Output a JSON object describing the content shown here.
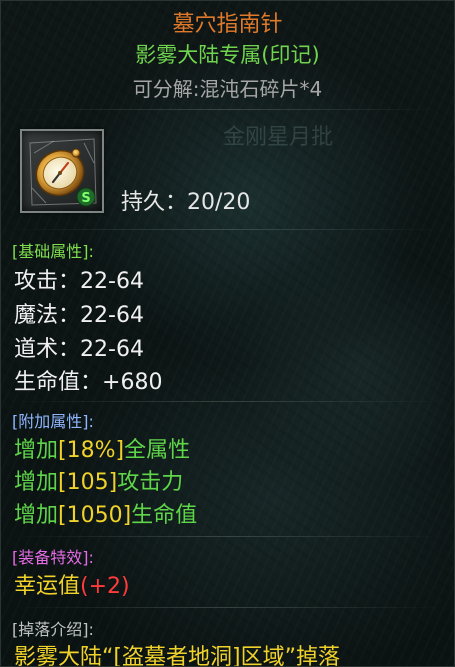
{
  "item": {
    "name": "墓穴指南针",
    "exclusive": "影雾大陆专属(印记)",
    "decompose": "可分解:混沌石碎片*4",
    "watermark": "金刚星月批",
    "icon_badge": "S",
    "durability": "持久：20/20"
  },
  "sections": {
    "basic": {
      "label": "[基础属性]:",
      "stats": [
        {
          "name": "攻击：",
          "value": "22-64"
        },
        {
          "name": "魔法：",
          "value": "22-64"
        },
        {
          "name": "道术：",
          "value": "22-64"
        },
        {
          "name": "生命值：",
          "value": "+680"
        }
      ]
    },
    "extra": {
      "label": "[附加属性]:",
      "lines": [
        {
          "prefix": "增加",
          "value": "[18%]",
          "suffix": "全属性"
        },
        {
          "prefix": "增加",
          "value": "[105]",
          "suffix": "攻击力"
        },
        {
          "prefix": "增加",
          "value": "[1050]",
          "suffix": "生命值"
        }
      ]
    },
    "effect": {
      "label": "[装备特效]:",
      "name": "幸运值",
      "value": "(+2)"
    },
    "drop": {
      "label": "[掉落介绍]:",
      "text": "影雾大陆“[盗墓者地洞]区域”掉落"
    }
  },
  "colors": {
    "name": "#e07a2a",
    "exclusive": "#6fd54e",
    "extra_green": "#5fd649",
    "highlight_yellow": "#f0d22a",
    "effect_red": "#ff3b3b"
  },
  "icon": "compass-icon"
}
